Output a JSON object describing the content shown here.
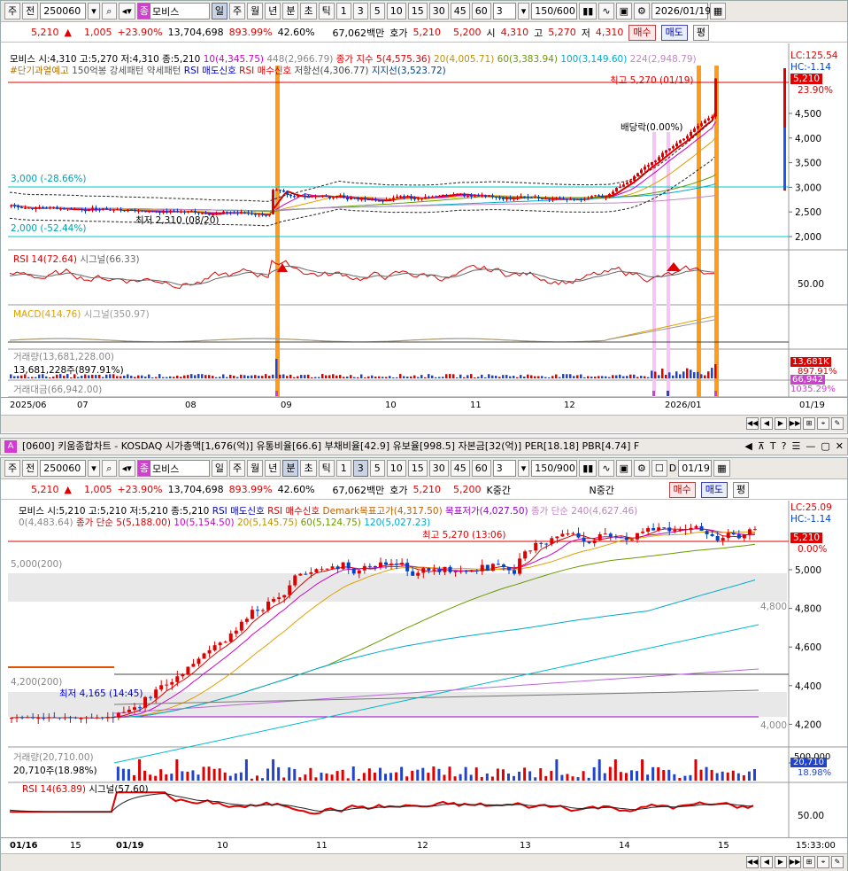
{
  "toolbar": {
    "type1": "주",
    "type2": "전",
    "code": "250060",
    "jong": "종",
    "name": "모비스",
    "periods": [
      "일",
      "주",
      "월",
      "년"
    ],
    "min": "분",
    "cho": "초",
    "tick": "틱",
    "nums": [
      "1",
      "3",
      "5",
      "10",
      "15",
      "30",
      "45",
      "60"
    ],
    "sel": "3",
    "count": "150/600",
    "date": "2026/01/19"
  },
  "quote": {
    "price": "5,210",
    "arrow": "▲",
    "change": "1,005",
    "rate": "+23.90%",
    "volume": "13,704,698",
    "vrate": "893.99%",
    "turn": "42.60%",
    "amount": "67,062백만",
    "hoga": "호가",
    "bid": "5,210",
    "ask": "5,200",
    "open_l": "시",
    "open": "4,310",
    "high_l": "고",
    "high": "5,270",
    "low_l": "저",
    "low": "4,310",
    "buy": "매수",
    "sell": "매도",
    "avg": "평"
  },
  "ch1": {
    "line1": [
      "모비스 시:4,310 고:5,270 저:4,310 종:5,210",
      "10(4,345.75)",
      "448(2,966.79)",
      "종가 지수 5(4,575.36)",
      "20(4,005.71)",
      "60(3,383.94)",
      "100(3,149.60)",
      "224(2,948.79)"
    ],
    "line2": [
      "#단기과열예고",
      "150억봉 강세패턴",
      "약세패턴",
      "RSI 매도신호",
      "RSI 매수신호",
      "저항선(4,306.77)",
      "지지선(3,523.72)"
    ],
    "right": [
      "LC:125.54",
      "HC:-1.14",
      "5,210",
      "23.90%"
    ],
    "ticks": [
      "4,500",
      "4,000",
      "3,500",
      "3,000",
      "2,500",
      "2,000"
    ],
    "labels": {
      "high": "최고 5,270 (01/19)",
      "low": "최저 2,310 (08/20)",
      "div": "배당락(0.00%)",
      "l3000": "3,000 (-28.66%)",
      "l2000": "2,000 (-52.44%)"
    },
    "rsi": "RSI 14(72.64)",
    "rsisig": "시그널(66.33)",
    "rsitick": "50.00",
    "macd": "MACD(414.76)",
    "macdsig": "시그널(350.97)",
    "vol": "거래량(13,681,228.00)",
    "vol2": "13,681,228주(897.91%)",
    "volr": [
      "13,681K",
      "897.91%"
    ],
    "amt": "거래대금(66,942.00)",
    "amtr": [
      "66,942",
      "1035.29%"
    ],
    "dates": [
      "2025/06",
      "07",
      "08",
      "09",
      "10",
      "11",
      "12",
      "2026/01",
      "01/19"
    ]
  },
  "title2": {
    "icon": "A",
    "text": "[0600] 키움종합차트 - KOSDAQ 시가총액[1,676(억)] 유통비율[66.6] 부채비율[42.9] 유보율[998.5] 자본금[32(억)] PER[18.18] PBR[4.74] F"
  },
  "toolbar2": {
    "count": "150/900",
    "date": "01/19",
    "sel": "3",
    "nums": [
      "1",
      "3",
      "5",
      "10",
      "15",
      "30",
      "45",
      "60"
    ],
    "d": "D"
  },
  "quote2": {
    "k1": "K중간",
    "k2": "N중간"
  },
  "ch2": {
    "line1": [
      "모비스 시:5,210 고:5,210 저:5,210 종:5,210",
      "RSI 매도신호",
      "RSI 매수신호",
      "Demark목표고가(4,317.50)",
      "목표저가(4,027.50)",
      "종가 단순 240(4,627.46)"
    ],
    "line2": [
      "0(4,483.64)",
      "종가 단순 5(5,188.00)",
      "10(5,154.50)",
      "20(5,145.75)",
      "60(5,124.75)",
      "120(5,027.23)"
    ],
    "right": [
      "LC:25.09",
      "HC:-1.14",
      "5,210",
      "0.00%"
    ],
    "ticks": [
      "5,000",
      "4,800",
      "4,600",
      "4,400",
      "4,200",
      "4,000"
    ],
    "labels": {
      "high": "최고 5,270 (13:06)",
      "low": "최저 4,165 (14:45)",
      "l5000": "5,000(200)",
      "l4200": "4,200(200)",
      "r4800": "4,800",
      "r4000": "4,000"
    },
    "vol": "거래량(20,710.00)",
    "vol2": "20,710주(18.98%)",
    "volr": [
      "500,000",
      "20,710",
      "18.98%"
    ],
    "rsi": "RSI 14(63.89)",
    "rsisig": "시그널(57.60)",
    "rsitick": "50.00",
    "dates": [
      "01/16",
      "15",
      "01/19",
      "10",
      "11",
      "12",
      "13",
      "14",
      "15",
      "15:33:00"
    ]
  }
}
